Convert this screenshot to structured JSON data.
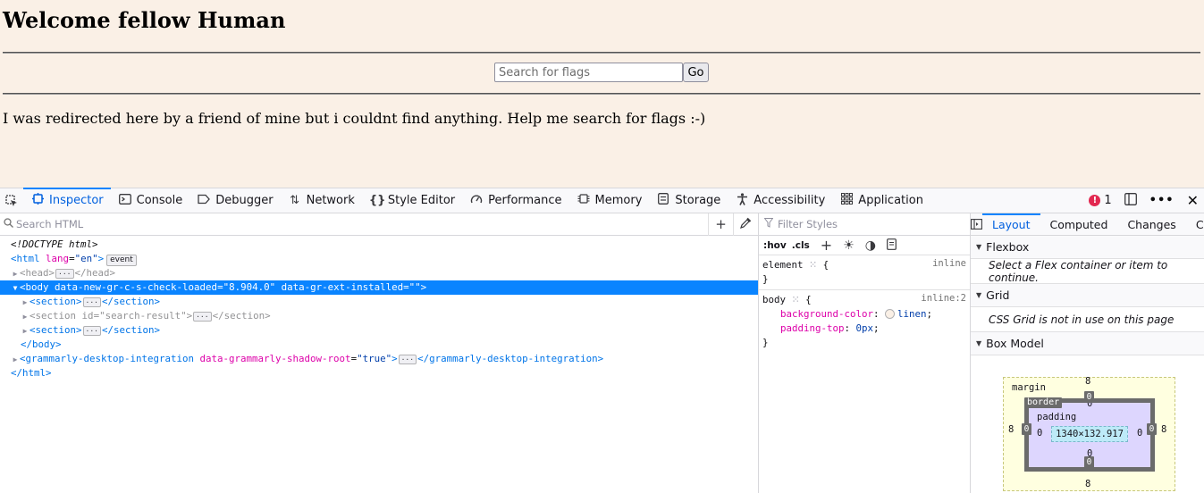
{
  "page": {
    "heading": "Welcome fellow Human",
    "search_placeholder": "Search for flags",
    "go_label": "Go",
    "message": "I was redirected here by a friend of mine but i couldnt find anything. Help me search for flags :-)"
  },
  "toolbar": {
    "tabs": [
      {
        "label": "Inspector",
        "icon": "inspector-icon"
      },
      {
        "label": "Console",
        "icon": "console-icon"
      },
      {
        "label": "Debugger",
        "icon": "debugger-icon"
      },
      {
        "label": "Network",
        "icon": "network-icon"
      },
      {
        "label": "Style Editor",
        "icon": "style-editor-icon"
      },
      {
        "label": "Performance",
        "icon": "performance-icon"
      },
      {
        "label": "Memory",
        "icon": "memory-icon"
      },
      {
        "label": "Storage",
        "icon": "storage-icon"
      },
      {
        "label": "Accessibility",
        "icon": "accessibility-icon"
      },
      {
        "label": "Application",
        "icon": "application-icon"
      }
    ],
    "active_tab": "Inspector",
    "error_count": "1"
  },
  "markup": {
    "search_placeholder": "Search HTML",
    "doctype": "<!DOCTYPE html>",
    "html_tag": "html",
    "html_attr": "lang",
    "html_val": "\"en\"",
    "event_badge": "event",
    "head_tag": "head",
    "body_tag": "body",
    "body_attr1": "data-new-gr-c-s-check-loaded",
    "body_val1": "\"8.904.0\"",
    "body_attr2": "data-gr-ext-installed",
    "body_val2": "\"\"",
    "section_tag": "section",
    "section2_attr": "id",
    "section2_val": "\"search-result\"",
    "grammarly_tag": "grammarly-desktop-integration",
    "grammarly_attr": "data-grammarly-shadow-root",
    "grammarly_val": "\"true\""
  },
  "rules": {
    "filter_placeholder": "Filter Styles",
    "hov_label": ":hov",
    "cls_label": ".cls",
    "element_selector": "element",
    "element_source": "inline",
    "body_selector": "body",
    "body_source": "inline:2",
    "decl1_prop": "background-color",
    "decl1_val": "linen",
    "decl2_prop": "padding-top",
    "decl2_val": "0px",
    "swatch_color": "#faf0e6"
  },
  "layout": {
    "tabs": [
      "Layout",
      "Computed",
      "Changes",
      "C"
    ],
    "active_tab": "Layout",
    "flexbox_title": "Flexbox",
    "flexbox_msg": "Select a Flex container or item to continue.",
    "grid_title": "Grid",
    "grid_msg": "CSS Grid is not in use on this page",
    "boxmodel_title": "Box Model",
    "box": {
      "margin_label": "margin",
      "border_label": "border",
      "padding_label": "padding",
      "content_size": "1340×132.917",
      "margin_top": "8",
      "margin_right": "8",
      "margin_bottom": "8",
      "margin_left": "8",
      "border_top": "0",
      "border_right": "0",
      "border_bottom": "0",
      "border_left": "0",
      "padding_top": "0",
      "padding_right": "0",
      "padding_bottom": "0",
      "padding_left": "0"
    }
  }
}
